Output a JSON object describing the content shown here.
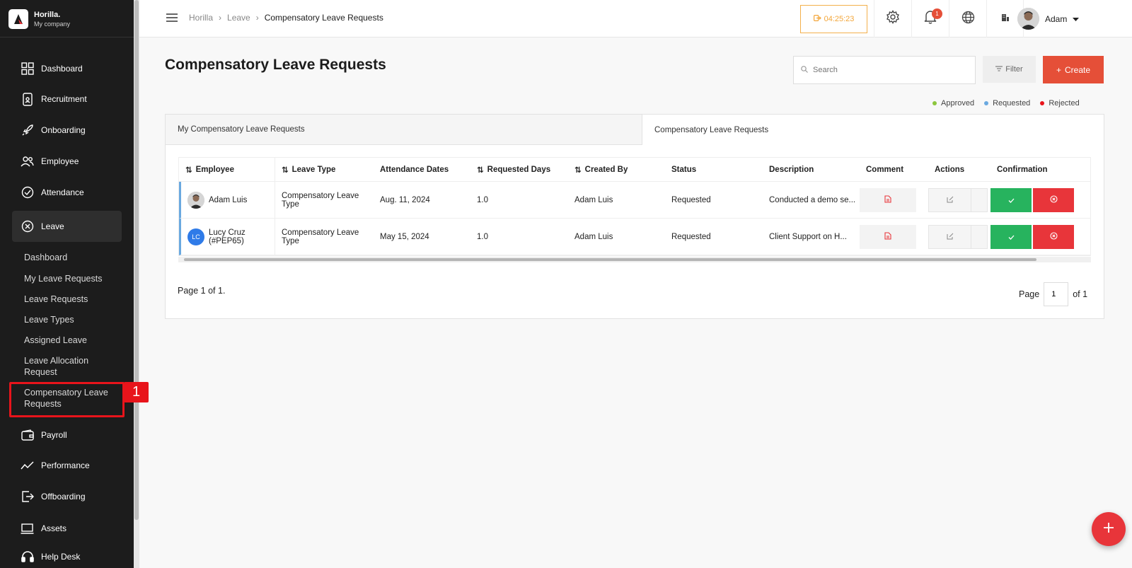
{
  "brand": {
    "name": "Horilla.",
    "company": "My company"
  },
  "sidebar": {
    "items": [
      {
        "label": "Dashboard"
      },
      {
        "label": "Recruitment"
      },
      {
        "label": "Onboarding"
      },
      {
        "label": "Employee"
      },
      {
        "label": "Attendance"
      },
      {
        "label": "Leave"
      },
      {
        "label": "Payroll"
      },
      {
        "label": "Performance"
      },
      {
        "label": "Offboarding"
      },
      {
        "label": "Assets"
      },
      {
        "label": "Help Desk"
      }
    ],
    "leave_sub": [
      {
        "label": "Dashboard"
      },
      {
        "label": "My Leave Requests"
      },
      {
        "label": "Leave Requests"
      },
      {
        "label": "Leave Types"
      },
      {
        "label": "Assigned Leave"
      },
      {
        "label": "Leave Allocation Request"
      },
      {
        "label": "Compensatory Leave Requests"
      }
    ],
    "highlight_badge": "1"
  },
  "topbar": {
    "breadcrumb": [
      "Horilla",
      "Leave",
      "Compensatory Leave Requests"
    ],
    "timer": "04:25:23",
    "notification_count": "1",
    "user_name": "Adam"
  },
  "page": {
    "title": "Compensatory Leave Requests",
    "search_placeholder": "Search",
    "filter_label": "Filter",
    "create_label": "Create",
    "legend": [
      {
        "label": "Approved",
        "color": "#8cc63e"
      },
      {
        "label": "Requested",
        "color": "#6aa9e0"
      },
      {
        "label": "Rejected",
        "color": "#e8141b"
      }
    ],
    "tabs": [
      "My Compensatory Leave Requests",
      "Compensatory Leave Requests"
    ]
  },
  "table": {
    "headers": [
      "Employee",
      "Leave Type",
      "Attendance Dates",
      "Requested Days",
      "Created By",
      "Status",
      "Description",
      "Comment",
      "Actions",
      "Confirmation"
    ],
    "rows": [
      {
        "employee": "Adam Luis",
        "leave_type": "Compensatory Leave Type",
        "dates": "Aug. 11, 2024",
        "days": "1.0",
        "created_by": "Adam Luis",
        "status": "Requested",
        "description": "Conducted a demo se..."
      },
      {
        "employee": "Lucy Cruz (#PEP65)",
        "initials": "LC",
        "leave_type": "Compensatory Leave Type",
        "dates": "May 15, 2024",
        "days": "1.0",
        "created_by": "Adam Luis",
        "status": "Requested",
        "description": "Client Support on H..."
      }
    ]
  },
  "pagination": {
    "info": "Page 1 of 1.",
    "page_label": "Page",
    "current": "1",
    "of_label": "of 1"
  }
}
